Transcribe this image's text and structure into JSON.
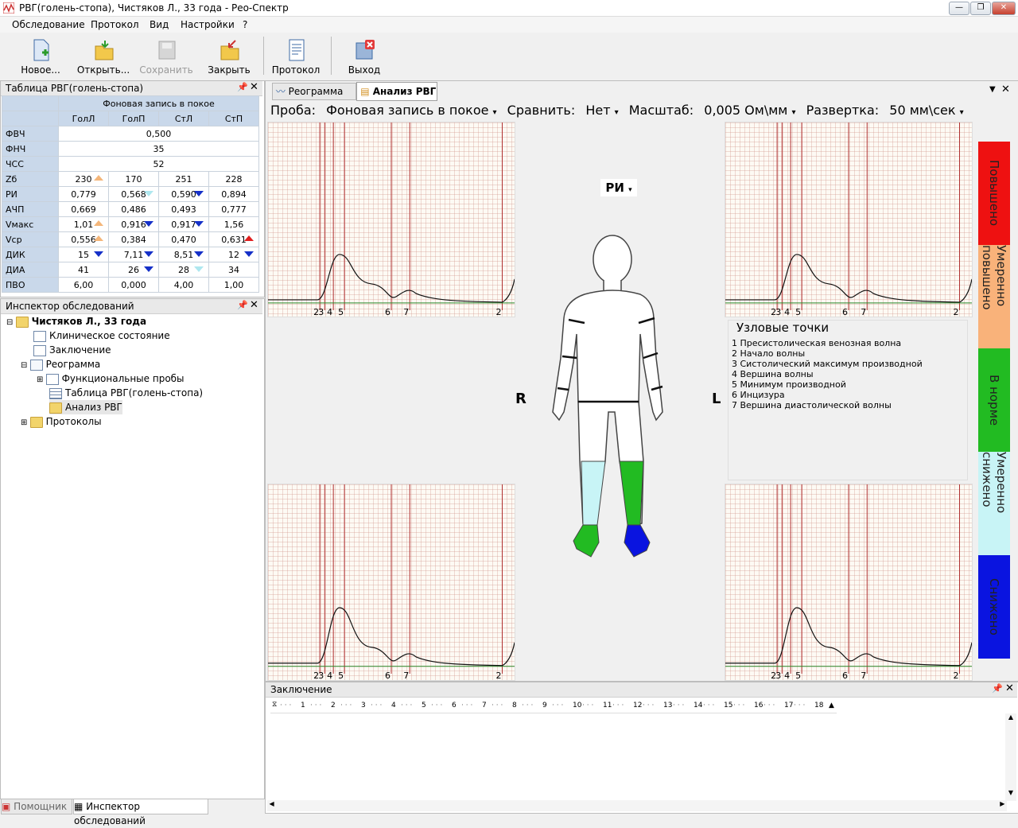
{
  "window": {
    "title": "РВГ(голень-стопа), Чистяков Л., 33 года  - Рео-Спектр"
  },
  "menu": [
    "Обследование",
    "Протокол",
    "Вид",
    "Настройки",
    "?"
  ],
  "toolbar": {
    "new": "Новое...",
    "open": "Открыть...",
    "save": "Сохранить",
    "close": "Закрыть",
    "protocol": "Протокол",
    "exit": "Выход"
  },
  "table_panel": {
    "title": "Таблица РВГ(голень-стопа)",
    "group_header": "Фоновая запись в покое",
    "columns": [
      "ГолЛ",
      "ГолП",
      "СтЛ",
      "СтП"
    ],
    "merged_rows": [
      {
        "label": "ФВЧ",
        "value": "0,500"
      },
      {
        "label": "ФНЧ",
        "value": "35"
      },
      {
        "label": "ЧСС",
        "value": "52"
      }
    ],
    "rows": [
      {
        "label": "Zб",
        "cells": [
          "230",
          "170",
          "251",
          "228"
        ]
      },
      {
        "label": "РИ",
        "cells": [
          "0,779",
          "0,568",
          "0,590",
          "0,894"
        ]
      },
      {
        "label": "АЧП",
        "cells": [
          "0,669",
          "0,486",
          "0,493",
          "0,777"
        ]
      },
      {
        "label": "Vмакс",
        "cells": [
          "1,01",
          "0,916",
          "0,917",
          "1,56"
        ]
      },
      {
        "label": "Vср",
        "cells": [
          "0,556",
          "0,384",
          "0,470",
          "0,631"
        ]
      },
      {
        "label": "ДИК",
        "cells": [
          "15",
          "7,11",
          "8,51",
          "12"
        ]
      },
      {
        "label": "ДИА",
        "cells": [
          "41",
          "26",
          "28",
          "34"
        ]
      },
      {
        "label": "ПВО",
        "cells": [
          "6,00",
          "0,000",
          "4,00",
          "1,00"
        ]
      }
    ]
  },
  "inspector": {
    "title": "Инспектор обследований",
    "items": [
      "Чистяков Л., 33 года",
      "Клиническое состояние",
      "Заключение",
      "Реограмма",
      "Функциональные пробы",
      "Таблица РВГ(голень-стопа)",
      "Анализ РВГ",
      "Протоколы"
    ]
  },
  "tabs": [
    "Реограмма",
    "Анализ РВГ"
  ],
  "controls": {
    "probe_label": "Проба:",
    "probe_value": "Фоновая запись в покое",
    "compare_label": "Сравнить:",
    "compare_value": "Нет",
    "scale_label": "Масштаб:",
    "scale_value": "0,005 Ом\\мм",
    "sweep_label": "Развертка:",
    "sweep_value": "50 мм\\сек"
  },
  "body": {
    "index_selector": "РИ",
    "right_label": "R",
    "left_label": "L"
  },
  "nodes": {
    "title": "Узловые точки",
    "items": [
      "1 Пресистолическая венозная волна",
      "2 Начало волны",
      "3 Систолический максимум производной",
      "4 Вершина волны",
      "5 Минимум производной",
      "6 Инцизура",
      "7 Вершина диастолической волны"
    ]
  },
  "wave_marks": [
    "2",
    "3",
    "4",
    "5",
    "6",
    "7",
    "2"
  ],
  "scale_legend": [
    {
      "label": "Повышено",
      "color": "#ee1111"
    },
    {
      "label": "Умеренно повышено",
      "color": "#f9b27a"
    },
    {
      "label": "В норме",
      "color": "#22bb22"
    },
    {
      "label": "Умеренно снижено",
      "color": "#c8f4f6"
    },
    {
      "label": "Снижено",
      "color": "#0a14e0"
    }
  ],
  "conclusion": {
    "title": "Заключение",
    "ruler": [
      "1",
      "2",
      "3",
      "4",
      "5",
      "6",
      "7",
      "8",
      "9",
      "10",
      "11",
      "12",
      "13",
      "14",
      "15",
      "16",
      "17",
      "18"
    ]
  },
  "bottom_tabs": [
    "Помощник",
    "Инспектор обследований"
  ]
}
